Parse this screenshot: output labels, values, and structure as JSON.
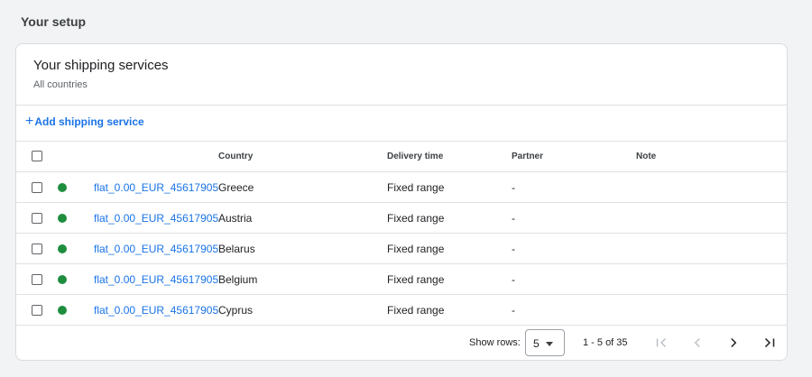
{
  "section": {
    "title": "Your setup"
  },
  "card": {
    "title": "Your shipping services",
    "subtitle": "All countries"
  },
  "add_button": {
    "icon": "plus-icon",
    "label": "Add shipping service"
  },
  "table": {
    "columns": {
      "country": "Country",
      "delivery_time": "Delivery time",
      "partner": "Partner",
      "note": "Note"
    },
    "rows": [
      {
        "name": "flat_0.00_EUR_45617905",
        "country": "Greece",
        "delivery_time": "Fixed range",
        "partner": "-",
        "status_color": "#1e8e3e"
      },
      {
        "name": "flat_0.00_EUR_45617905",
        "country": "Austria",
        "delivery_time": "Fixed range",
        "partner": "-",
        "status_color": "#1e8e3e"
      },
      {
        "name": "flat_0.00_EUR_45617905",
        "country": "Belarus",
        "delivery_time": "Fixed range",
        "partner": "-",
        "status_color": "#1e8e3e"
      },
      {
        "name": "flat_0.00_EUR_45617905",
        "country": "Belgium",
        "delivery_time": "Fixed range",
        "partner": "-",
        "status_color": "#1e8e3e"
      },
      {
        "name": "flat_0.00_EUR_45617905",
        "country": "Cyprus",
        "delivery_time": "Fixed range",
        "partner": "-",
        "status_color": "#1e8e3e"
      }
    ]
  },
  "pagination": {
    "rows_label": "Show rows:",
    "rows_value": "5",
    "range": "1 - 5 of 35",
    "icons": [
      "first-page-icon",
      "previous-page-icon",
      "next-page-icon",
      "last-page-icon"
    ]
  },
  "colors": {
    "accent": "#1a73e8",
    "status_active": "#1e8e3e",
    "disabled": "#bdc1c6"
  }
}
